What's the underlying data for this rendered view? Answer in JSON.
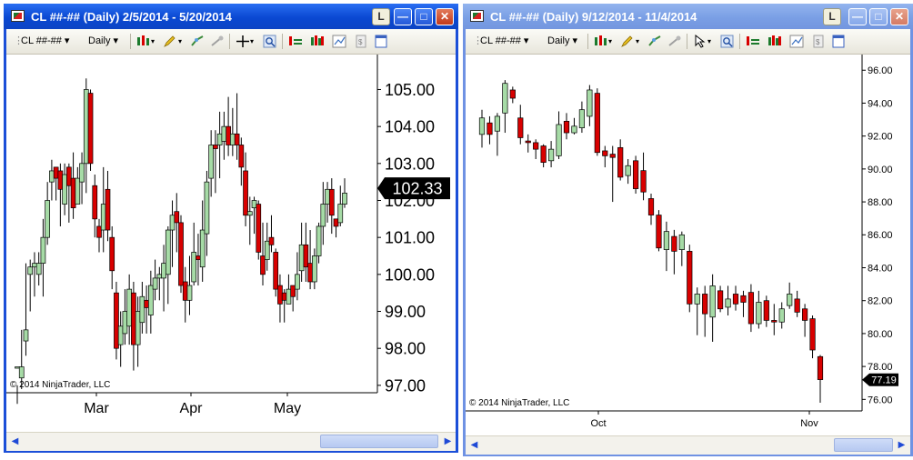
{
  "windows": [
    {
      "title": "CL ##-## (Daily)  2/5/2014 - 5/20/2014",
      "buttons": {
        "layout": "L",
        "minimize": "—",
        "maximize": "□",
        "close": "✕"
      },
      "toolbar": {
        "instrument": "CL ##-##",
        "interval": "Daily"
      },
      "copyright": "© 2014 NinjaTrader, LLC",
      "last_price": "102.33"
    },
    {
      "title": "CL ##-## (Daily)  9/12/2014 - 11/4/2014",
      "buttons": {
        "layout": "L",
        "minimize": "—",
        "maximize": "□",
        "close": "✕"
      },
      "toolbar": {
        "instrument": "CL ##-##",
        "interval": "Daily"
      },
      "copyright": "© 2014 NinjaTrader, LLC",
      "last_price": "77.19"
    }
  ],
  "colors": {
    "up": "#a6dba6",
    "down": "#d80000",
    "active_title": "#0a48d2",
    "inactive_title": "#7a9fe5"
  },
  "chart_data": [
    {
      "type": "candlestick",
      "y_ticks": [
        "105.00",
        "104.00",
        "103.00",
        "102.00",
        "101.00",
        "100.00",
        "99.00",
        "98.00",
        "97.00"
      ],
      "ylim": [
        96.8,
        105.7
      ],
      "x_ticks": [
        "Mar",
        "Apr",
        "May"
      ],
      "candles": [
        [
          97.5,
          97.5,
          97.0,
          96.5
        ],
        [
          97.2,
          97.5,
          98.5,
          96.9
        ],
        [
          98.2,
          98.5,
          100.3,
          97.8
        ],
        [
          100.0,
          100.2,
          100.4,
          99.0
        ],
        [
          100.2,
          100.3,
          100.6,
          99.4
        ],
        [
          100.0,
          100.3,
          100.6,
          99.7
        ],
        [
          100.3,
          101.0,
          101.5,
          99.4
        ],
        [
          101.0,
          102.0,
          102.5,
          100.8
        ],
        [
          102.5,
          102.8,
          103.1,
          102.0
        ],
        [
          102.9,
          102.6,
          102.9,
          102.0
        ],
        [
          102.8,
          102.3,
          103.0,
          101.3
        ],
        [
          101.9,
          102.7,
          103.0,
          101.6
        ],
        [
          102.9,
          102.4,
          103.0,
          101.4
        ],
        [
          102.6,
          101.8,
          103.3,
          101.5
        ],
        [
          101.9,
          102.6,
          102.9,
          101.9
        ],
        [
          102.5,
          103.0,
          103.3,
          101.9
        ],
        [
          103.0,
          105.0,
          105.3,
          102.2
        ],
        [
          104.9,
          103.0,
          105.0,
          102.8
        ],
        [
          102.4,
          101.5,
          102.7,
          101.0
        ],
        [
          101.3,
          101.0,
          101.5,
          100.6
        ],
        [
          101.2,
          101.9,
          102.9,
          100.6
        ],
        [
          102.3,
          101.2,
          102.8,
          100.9
        ],
        [
          101.0,
          100.1,
          101.3,
          99.6
        ],
        [
          99.5,
          98.0,
          99.8,
          97.7
        ],
        [
          98.1,
          98.6,
          99.0,
          97.5
        ],
        [
          98.4,
          99.0,
          99.6,
          98.1
        ],
        [
          98.6,
          99.6,
          100.0,
          98.1
        ],
        [
          99.5,
          98.1,
          99.8,
          97.4
        ],
        [
          98.1,
          99.0,
          99.4,
          97.5
        ],
        [
          98.7,
          99.4,
          99.8,
          98.4
        ],
        [
          99.3,
          99.1,
          99.7,
          98.4
        ],
        [
          98.9,
          99.7,
          100.1,
          98.4
        ],
        [
          99.6,
          99.9,
          100.4,
          99.3
        ],
        [
          99.9,
          100.0,
          100.2,
          99.3
        ],
        [
          99.9,
          100.3,
          100.8,
          99.0
        ],
        [
          100.0,
          101.2,
          101.3,
          99.2
        ],
        [
          101.2,
          101.6,
          102.0,
          100.2
        ],
        [
          101.7,
          101.4,
          102.2,
          100.6
        ],
        [
          101.4,
          99.7,
          101.6,
          99.5
        ],
        [
          99.8,
          99.3,
          100.2,
          98.7
        ],
        [
          99.3,
          99.7,
          100.5,
          98.9
        ],
        [
          99.8,
          100.6,
          101.4,
          99.7
        ],
        [
          100.5,
          100.4,
          101.1,
          99.7
        ],
        [
          100.2,
          101.2,
          102.0,
          99.8
        ],
        [
          101.1,
          102.5,
          102.8,
          100.5
        ],
        [
          102.6,
          103.5,
          103.9,
          102.1
        ],
        [
          103.5,
          103.4,
          103.9,
          102.2
        ],
        [
          103.5,
          103.8,
          104.4,
          102.6
        ],
        [
          103.6,
          104.0,
          104.4,
          103.1
        ],
        [
          104.0,
          103.5,
          104.8,
          103.2
        ],
        [
          103.5,
          103.8,
          104.5,
          103.2
        ],
        [
          103.8,
          103.5,
          104.9,
          103.1
        ],
        [
          103.5,
          102.9,
          103.7,
          102.4
        ],
        [
          102.8,
          101.6,
          103.3,
          101.3
        ],
        [
          101.6,
          101.7,
          102.1,
          100.8
        ],
        [
          101.8,
          102.0,
          102.1,
          101.1
        ],
        [
          101.9,
          100.6,
          102.0,
          100.4
        ],
        [
          100.5,
          100.0,
          101.4,
          99.7
        ],
        [
          100.4,
          100.9,
          101.4,
          100.1
        ],
        [
          101.0,
          100.8,
          101.6,
          100.6
        ],
        [
          100.6,
          99.6,
          100.7,
          99.4
        ],
        [
          99.7,
          99.2,
          100.0,
          98.7
        ],
        [
          99.5,
          99.3,
          99.6,
          98.7
        ],
        [
          99.2,
          99.6,
          100.0,
          99.3
        ],
        [
          99.7,
          99.4,
          99.7,
          99.0
        ],
        [
          99.6,
          100.0,
          100.6,
          99.3
        ],
        [
          100.1,
          100.8,
          101.4,
          99.8
        ],
        [
          100.8,
          100.2,
          101.4,
          99.8
        ],
        [
          100.3,
          99.8,
          101.2,
          99.6
        ],
        [
          99.8,
          100.5,
          100.7,
          99.6
        ],
        [
          100.5,
          101.3,
          101.4,
          100.3
        ],
        [
          101.3,
          101.9,
          102.5,
          100.8
        ],
        [
          101.9,
          102.3,
          102.5,
          101.4
        ],
        [
          102.3,
          101.6,
          102.6,
          101.1
        ],
        [
          101.5,
          101.3,
          101.5,
          101.0
        ],
        [
          101.4,
          101.9,
          102.4,
          101.3
        ],
        [
          101.9,
          102.2,
          102.6,
          101.8
        ]
      ]
    },
    {
      "type": "candlestick",
      "y_ticks": [
        "96.00",
        "94.00",
        "92.00",
        "90.00",
        "88.00",
        "86.00",
        "84.00",
        "82.00",
        "80.00",
        "78.00",
        "76.00"
      ],
      "ylim": [
        75.3,
        96.4
      ],
      "x_ticks": [
        "Oct",
        "Nov"
      ],
      "candles": [
        [
          92.1,
          93.1,
          93.6,
          91.3
        ],
        [
          92.8,
          92.1,
          93.2,
          91.5
        ],
        [
          92.3,
          93.2,
          93.4,
          90.8
        ],
        [
          93.4,
          95.2,
          95.4,
          92.2
        ],
        [
          94.8,
          94.3,
          95.0,
          94.0
        ],
        [
          93.1,
          91.9,
          93.9,
          91.5
        ],
        [
          91.7,
          91.6,
          92.1,
          91.0
        ],
        [
          91.6,
          91.2,
          91.8,
          90.6
        ],
        [
          91.4,
          90.4,
          91.5,
          90.1
        ],
        [
          90.5,
          91.2,
          91.7,
          90.1
        ],
        [
          90.8,
          92.7,
          93.5,
          90.6
        ],
        [
          92.9,
          92.2,
          93.4,
          91.8
        ],
        [
          92.2,
          92.6,
          93.1,
          92.1
        ],
        [
          92.5,
          93.6,
          94.1,
          92.2
        ],
        [
          93.2,
          94.8,
          95.1,
          92.6
        ],
        [
          94.6,
          91.0,
          94.9,
          90.8
        ],
        [
          91.1,
          90.8,
          91.4,
          90.1
        ],
        [
          90.9,
          90.7,
          91.4,
          88.0
        ],
        [
          91.3,
          89.5,
          91.8,
          89.3
        ],
        [
          89.6,
          90.2,
          90.6,
          89.1
        ],
        [
          90.5,
          88.8,
          90.8,
          88.5
        ],
        [
          89.9,
          88.6,
          91.0,
          88.1
        ],
        [
          88.2,
          87.2,
          88.5,
          86.6
        ],
        [
          87.2,
          85.2,
          87.5,
          85.0
        ],
        [
          85.1,
          86.2,
          86.8,
          83.8
        ],
        [
          85.9,
          85.0,
          86.3,
          83.6
        ],
        [
          85.1,
          86.0,
          86.2,
          84.1
        ],
        [
          85.0,
          81.8,
          85.4,
          81.3
        ],
        [
          81.8,
          82.4,
          82.8,
          79.9
        ],
        [
          82.4,
          81.2,
          82.9,
          79.8
        ],
        [
          81.0,
          82.9,
          83.6,
          79.5
        ],
        [
          82.6,
          81.5,
          82.9,
          81.3
        ],
        [
          81.6,
          82.1,
          82.9,
          81.1
        ],
        [
          82.4,
          81.8,
          82.9,
          81.4
        ],
        [
          82.3,
          81.9,
          82.6,
          81.0
        ],
        [
          82.5,
          80.6,
          83.0,
          80.1
        ],
        [
          80.6,
          81.9,
          82.6,
          80.3
        ],
        [
          82.0,
          80.8,
          82.3,
          80.4
        ],
        [
          80.8,
          80.7,
          81.8,
          79.9
        ],
        [
          80.7,
          81.5,
          81.9,
          80.3
        ],
        [
          81.7,
          82.4,
          83.1,
          81.5
        ],
        [
          82.1,
          81.3,
          82.6,
          81.0
        ],
        [
          81.5,
          80.8,
          81.8,
          79.8
        ],
        [
          80.9,
          79.0,
          81.1,
          78.5
        ],
        [
          78.6,
          77.2,
          78.7,
          75.8
        ]
      ]
    }
  ]
}
